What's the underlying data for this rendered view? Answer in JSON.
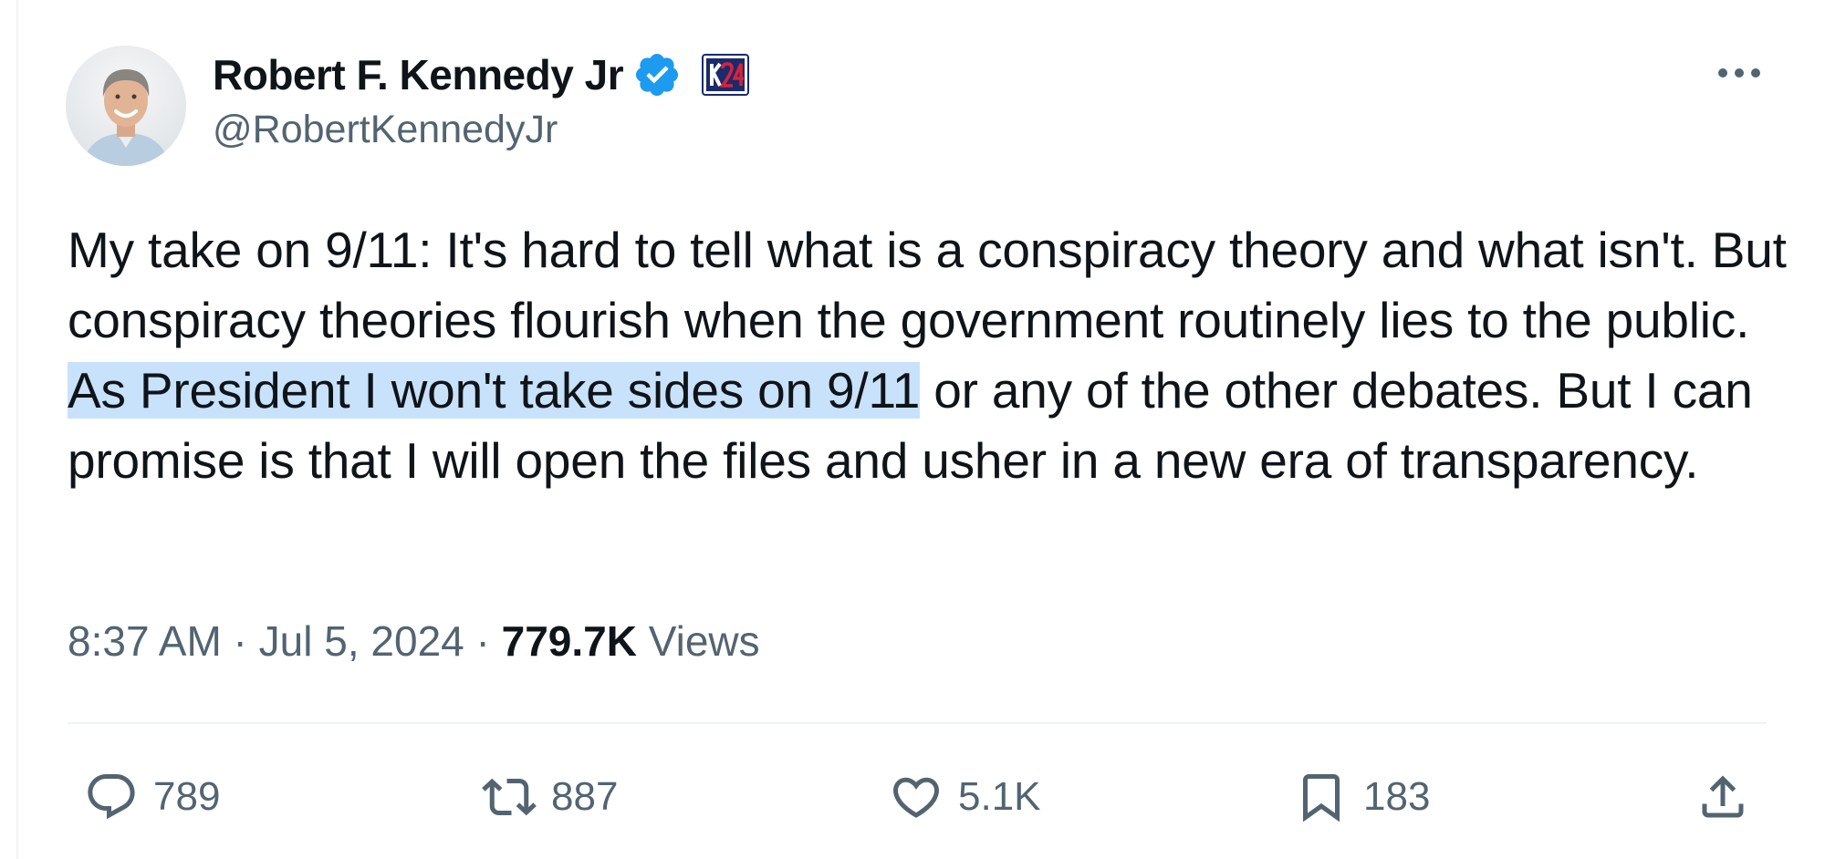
{
  "author": {
    "display_name": "Robert F. Kennedy Jr",
    "handle": "@RobertKennedyJr",
    "verified": true,
    "affiliation_badge_icon": "kennedy-24-badge-icon"
  },
  "tweet": {
    "text_before_highlight": "My take on 9/11: It's hard to tell what is a conspiracy theory and what isn't. But conspiracy theories flourish when the government routinely lies to the public. ",
    "text_highlight": "As President I won't take sides on 9/11",
    "text_after_highlight": " or any of the other debates. But I can promise is that I will open the files and usher in a new era of transparency."
  },
  "meta": {
    "time": "8:37 AM",
    "separator": " · ",
    "date": "Jul 5, 2024",
    "views_count": "779.7K",
    "views_label": " Views"
  },
  "actions": {
    "replies": "789",
    "reposts": "887",
    "likes": "5.1K",
    "bookmarks": "183"
  },
  "colors": {
    "text_primary": "#0f1419",
    "text_secondary": "#536471",
    "verified_blue": "#1d9bf0",
    "highlight": "#c9e2fb",
    "badge_navy": "#1b2a6b",
    "badge_red": "#d8223b"
  }
}
